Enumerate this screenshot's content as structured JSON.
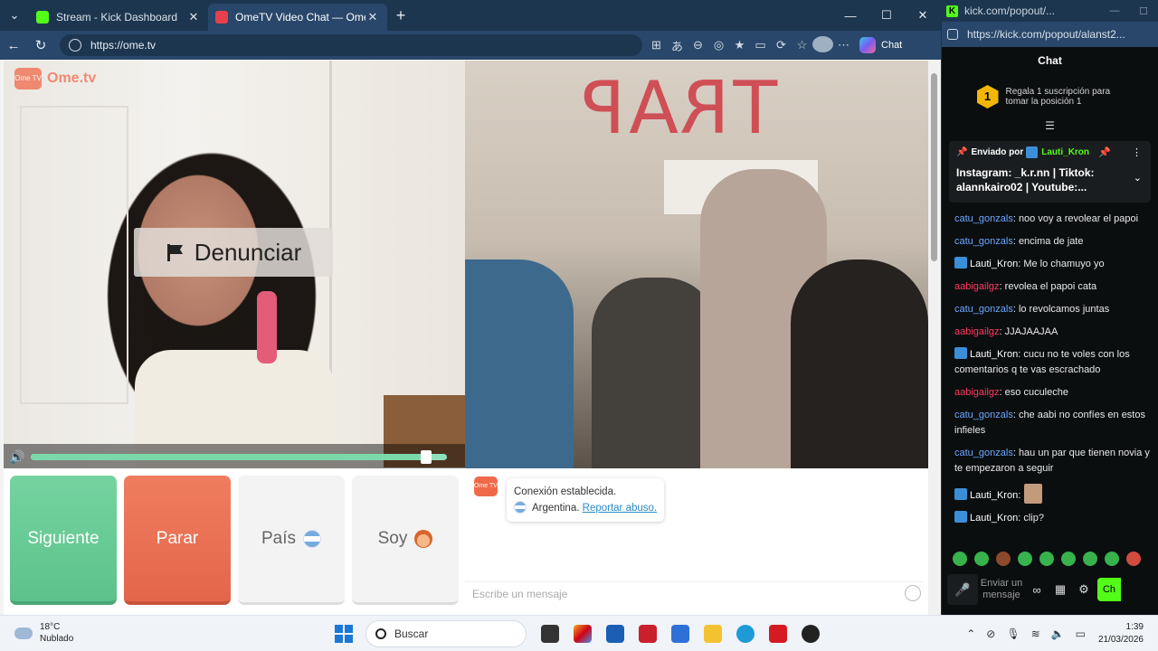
{
  "browser": {
    "tabs": [
      {
        "label": "Stream - Kick Dashboard",
        "active": false,
        "color": "#53fc18"
      },
      {
        "label": "OmeTV Video Chat — Omegl",
        "active": true,
        "color": "#e8404a"
      }
    ],
    "url": "https://ome.tv",
    "copilot_label": "Chat"
  },
  "ometv": {
    "logo_box": "Ome TV",
    "logo_word": "Ome.tv",
    "report_label": "Denunciar",
    "volume_level": 0.95,
    "buttons": {
      "next": "Siguiente",
      "stop": "Parar",
      "country": "País",
      "gender": "Soy"
    },
    "graffiti": "TRAP",
    "chat": {
      "status": "Conexión establecida.",
      "country": "Argentina.",
      "report_link": "Reportar abuso.",
      "placeholder": "Escribe un mensaje"
    }
  },
  "kick": {
    "window_title": "kick.com/popout/...",
    "url": "https://kick.com/popout/alanst2...",
    "header": "Chat",
    "sub_rank": "1",
    "sub_promo": "Regala 1 suscripción para tomar la posición 1",
    "pinned": {
      "sent_by": "Enviado por",
      "user": "Lauti_Kron",
      "text": "Instagram: _k.r.nn | Tiktok: alannkairo02 | Youtube:..."
    },
    "messages": [
      {
        "user": "catu_gonzals",
        "color": "blue",
        "badge": false,
        "text": ": noo voy a revolear el papoi"
      },
      {
        "user": "catu_gonzals",
        "color": "blue",
        "badge": false,
        "text": ": encima de jate"
      },
      {
        "user": "Lauti_Kron",
        "color": "white",
        "badge": true,
        "text": ": Me lo chamuyo yo"
      },
      {
        "user": "aabigailgz",
        "color": "red",
        "badge": false,
        "text": ": revolea el papoi cata"
      },
      {
        "user": "catu_gonzals",
        "color": "blue",
        "badge": false,
        "text": ": lo revolcamos juntas"
      },
      {
        "user": "aabigailgz",
        "color": "red",
        "badge": false,
        "text": ": JJAJAAJAA"
      },
      {
        "user": "Lauti_Kron",
        "color": "white",
        "badge": true,
        "text": ": cucu no te voles con los comentarios q te vas escrachado"
      },
      {
        "user": "aabigailgz",
        "color": "red",
        "badge": false,
        "text": ": eso cuculeche"
      },
      {
        "user": "catu_gonzals",
        "color": "blue",
        "badge": false,
        "text": ": che aabi no confíes en estos infieles"
      },
      {
        "user": "catu_gonzals",
        "color": "blue",
        "badge": false,
        "text": ": hau un par que tienen novia y te empezaron a seguir"
      },
      {
        "user": "Lauti_Kron",
        "color": "white",
        "badge": true,
        "text": ":",
        "emote": true
      },
      {
        "user": "Lauti_Kron",
        "color": "white",
        "badge": true,
        "text": ": clip?"
      }
    ],
    "send_label": "Enviar un mensaje",
    "chat_button": "Ch"
  },
  "taskbar": {
    "temp": "18°C",
    "weather": "Nublado",
    "search": "Buscar",
    "time": "1:39",
    "date": "21/03/2026"
  }
}
